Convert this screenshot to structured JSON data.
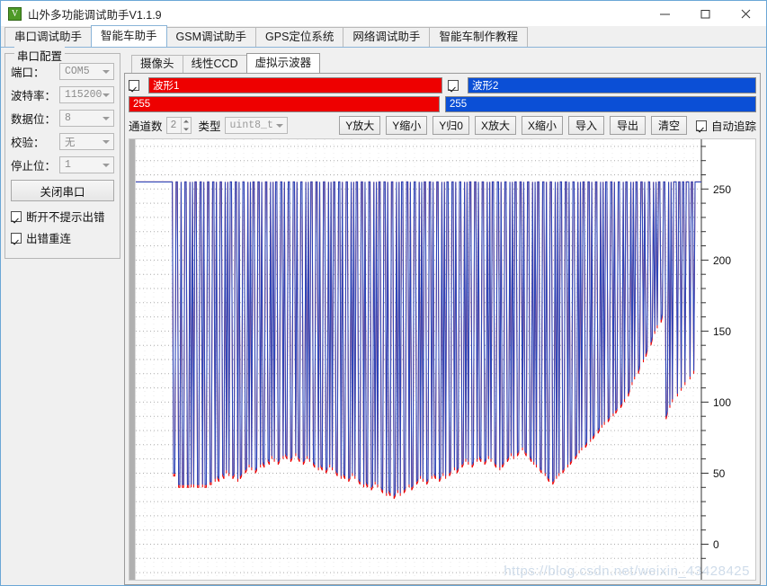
{
  "window": {
    "title": "山外多功能调试助手V1.1.9",
    "icon": "app-logo-icon",
    "minimize_label": "—",
    "maximize_label": "□",
    "close_label": "✕",
    "frame_color": "#6ba7d6"
  },
  "tabs": [
    {
      "label": "串口调试助手",
      "active": false
    },
    {
      "label": "智能车助手",
      "active": true
    },
    {
      "label": "GSM调试助手",
      "active": false
    },
    {
      "label": "GPS定位系统",
      "active": false
    },
    {
      "label": "网络调试助手",
      "active": false
    },
    {
      "label": "智能车制作教程",
      "active": false
    }
  ],
  "sidebar": {
    "group_title": "串口配置",
    "fields": [
      {
        "label": "端口：",
        "value": "COM5"
      },
      {
        "label": "波特率：",
        "value": "115200"
      },
      {
        "label": "数据位：",
        "value": "8"
      },
      {
        "label": "校验：",
        "value": "无"
      },
      {
        "label": "停止位：",
        "value": "1"
      }
    ],
    "action_button": "关闭串口",
    "checkboxes": [
      {
        "label": "断开不提示出错",
        "checked": true
      },
      {
        "label": "出错重连",
        "checked": true
      }
    ]
  },
  "inner_tabs": [
    {
      "label": "摄像头",
      "active": false
    },
    {
      "label": "线性CCD",
      "active": false
    },
    {
      "label": "虚拟示波器",
      "active": true
    }
  ],
  "scope": {
    "waves": [
      {
        "name": "波形1",
        "value": "255",
        "color": "#ee0000",
        "enabled": true
      },
      {
        "name": "波形2",
        "value": "255",
        "color": "#0b4fd6",
        "enabled": true
      }
    ],
    "channel_label": "通道数",
    "channel_count": "2",
    "type_label": "类型",
    "type_value": "uint8_t",
    "buttons": [
      "Y放大",
      "Y缩小",
      "Y归0",
      "X放大",
      "X缩小",
      "导入",
      "导出",
      "清空"
    ],
    "autotrack": {
      "label": "自动追踪",
      "checked": true
    },
    "watermark": "https://blog.csdn.net/weixin_43428425"
  },
  "chart_data": {
    "type": "line",
    "title": "",
    "xlabel": "",
    "ylabel": "",
    "grid": true,
    "legend": [
      "波形1",
      "波形2"
    ],
    "ylim": [
      -25,
      285
    ],
    "yticks": [
      0,
      50,
      100,
      150,
      200,
      250
    ],
    "yticks_minor_step": 10,
    "xlim": [
      0,
      470
    ],
    "series": [
      {
        "name": "波形1",
        "color": "#ee0000",
        "values": [
          255,
          255,
          255,
          255,
          255,
          255,
          255,
          255,
          255,
          255,
          255,
          255,
          255,
          255,
          255,
          255,
          255,
          255,
          255,
          255,
          255,
          255,
          255,
          255,
          255,
          255,
          255,
          255,
          255,
          255,
          48,
          48,
          255,
          255,
          40,
          40,
          255,
          40,
          40,
          255,
          255,
          40,
          40,
          255,
          40,
          255,
          40,
          255,
          255,
          40,
          40,
          255,
          255,
          40,
          255,
          40,
          40,
          255,
          255,
          42,
          42,
          255,
          255,
          44,
          255,
          46,
          44,
          255,
          255,
          48,
          46,
          255,
          50,
          255,
          48,
          255,
          255,
          46,
          48,
          255,
          255,
          44,
          255,
          46,
          48,
          255,
          255,
          50,
          52,
          255,
          54,
          255,
          52,
          255,
          255,
          50,
          52,
          255,
          255,
          54,
          255,
          56,
          54,
          255,
          255,
          58,
          56,
          255,
          60,
          255,
          58,
          255,
          255,
          56,
          58,
          255,
          255,
          60,
          255,
          62,
          60,
          255,
          255,
          58,
          60,
          255,
          255,
          62,
          255,
          60,
          58,
          255,
          255,
          56,
          58,
          255,
          60,
          255,
          58,
          255,
          255,
          56,
          54,
          255,
          255,
          52,
          255,
          54,
          52,
          255,
          255,
          50,
          52,
          255,
          54,
          255,
          52,
          255,
          255,
          50,
          48,
          255,
          255,
          46,
          255,
          48,
          46,
          255,
          255,
          44,
          46,
          255,
          48,
          255,
          46,
          255,
          255,
          44,
          42,
          255,
          255,
          40,
          255,
          42,
          40,
          255,
          255,
          38,
          40,
          255,
          42,
          255,
          40,
          255,
          255,
          38,
          36,
          255,
          255,
          34,
          255,
          36,
          34,
          255,
          255,
          32,
          34,
          255,
          36,
          255,
          34,
          255,
          255,
          36,
          38,
          255,
          255,
          40,
          255,
          38,
          40,
          255,
          255,
          42,
          44,
          255,
          46,
          255,
          44,
          255,
          255,
          42,
          44,
          255,
          255,
          46,
          255,
          48,
          46,
          255,
          255,
          44,
          46,
          255,
          48,
          255,
          46,
          255,
          255,
          48,
          50,
          255,
          255,
          52,
          255,
          50,
          52,
          255,
          255,
          54,
          56,
          255,
          58,
          255,
          56,
          255,
          255,
          54,
          56,
          255,
          255,
          58,
          255,
          60,
          58,
          255,
          255,
          56,
          58,
          255,
          60,
          255,
          58,
          255,
          255,
          56,
          54,
          255,
          255,
          52,
          255,
          54,
          56,
          255,
          255,
          58,
          60,
          255,
          62,
          255,
          60,
          255,
          255,
          62,
          64,
          255,
          255,
          66,
          255,
          64,
          62,
          255,
          255,
          60,
          58,
          255,
          56,
          255,
          54,
          255,
          255,
          52,
          50,
          255,
          255,
          48,
          255,
          46,
          44,
          255,
          255,
          42,
          44,
          255,
          46,
          255,
          48,
          255,
          255,
          50,
          52,
          255,
          255,
          54,
          255,
          56,
          58,
          255,
          255,
          60,
          62,
          255,
          64,
          255,
          66,
          255,
          255,
          68,
          70,
          255,
          255,
          72,
          255,
          74,
          76,
          255,
          255,
          78,
          80,
          255,
          82,
          255,
          84,
          255,
          255,
          86,
          88,
          255,
          255,
          90,
          255,
          92,
          94,
          255,
          255,
          96,
          98,
          255,
          100,
          255,
          255,
          104,
          108,
          255,
          112,
          255,
          116,
          255,
          255,
          120,
          124,
          255,
          255,
          128,
          255,
          132,
          136,
          255,
          255,
          140,
          144,
          255,
          148,
          255,
          152,
          255,
          255,
          156,
          160,
          255,
          255,
          88,
          92,
          255,
          96,
          255,
          100,
          255,
          255,
          255,
          104,
          255,
          255,
          108,
          255,
          255,
          112,
          255,
          255,
          255,
          116,
          255,
          255,
          120,
          255,
          255,
          255,
          255,
          255,
          255
        ]
      },
      {
        "name": "波形2",
        "color": "#0b4fd6",
        "values": [
          255,
          255,
          255,
          255,
          255,
          255,
          255,
          255,
          255,
          255,
          255,
          255,
          255,
          255,
          255,
          255,
          255,
          255,
          255,
          255,
          255,
          255,
          255,
          255,
          255,
          255,
          255,
          255,
          255,
          255,
          50,
          50,
          255,
          255,
          42,
          42,
          255,
          42,
          42,
          255,
          255,
          42,
          42,
          255,
          42,
          255,
          42,
          255,
          255,
          42,
          42,
          255,
          255,
          42,
          255,
          42,
          42,
          255,
          255,
          44,
          44,
          255,
          255,
          46,
          255,
          48,
          46,
          255,
          255,
          50,
          48,
          255,
          52,
          255,
          50,
          255,
          255,
          48,
          50,
          255,
          255,
          46,
          255,
          48,
          50,
          255,
          255,
          52,
          54,
          255,
          56,
          255,
          54,
          255,
          255,
          52,
          54,
          255,
          255,
          56,
          255,
          58,
          56,
          255,
          255,
          60,
          58,
          255,
          62,
          255,
          60,
          255,
          255,
          58,
          60,
          255,
          255,
          62,
          255,
          64,
          62,
          255,
          255,
          60,
          62,
          255,
          255,
          64,
          255,
          62,
          60,
          255,
          255,
          58,
          60,
          255,
          62,
          255,
          60,
          255,
          255,
          58,
          56,
          255,
          255,
          54,
          255,
          56,
          54,
          255,
          255,
          52,
          54,
          255,
          56,
          255,
          54,
          255,
          255,
          52,
          50,
          255,
          255,
          48,
          255,
          50,
          48,
          255,
          255,
          46,
          48,
          255,
          50,
          255,
          48,
          255,
          255,
          46,
          44,
          255,
          255,
          42,
          255,
          44,
          42,
          255,
          255,
          40,
          42,
          255,
          44,
          255,
          42,
          255,
          255,
          40,
          38,
          255,
          255,
          36,
          255,
          38,
          36,
          255,
          255,
          34,
          36,
          255,
          38,
          255,
          36,
          255,
          255,
          38,
          40,
          255,
          255,
          42,
          255,
          40,
          42,
          255,
          255,
          44,
          46,
          255,
          48,
          255,
          46,
          255,
          255,
          44,
          46,
          255,
          255,
          48,
          255,
          50,
          48,
          255,
          255,
          46,
          48,
          255,
          50,
          255,
          48,
          255,
          255,
          50,
          52,
          255,
          255,
          54,
          255,
          52,
          54,
          255,
          255,
          56,
          58,
          255,
          60,
          255,
          58,
          255,
          255,
          56,
          58,
          255,
          255,
          60,
          255,
          62,
          60,
          255,
          255,
          58,
          60,
          255,
          62,
          255,
          60,
          255,
          255,
          58,
          56,
          255,
          255,
          54,
          255,
          56,
          58,
          255,
          255,
          60,
          62,
          255,
          64,
          255,
          62,
          255,
          255,
          64,
          66,
          255,
          255,
          68,
          255,
          66,
          64,
          255,
          255,
          62,
          60,
          255,
          58,
          255,
          56,
          255,
          255,
          54,
          52,
          255,
          255,
          50,
          255,
          48,
          46,
          255,
          255,
          44,
          46,
          255,
          48,
          255,
          50,
          255,
          255,
          52,
          54,
          255,
          255,
          56,
          255,
          58,
          60,
          255,
          255,
          62,
          64,
          255,
          66,
          255,
          68,
          255,
          255,
          70,
          72,
          255,
          255,
          74,
          255,
          76,
          78,
          255,
          255,
          80,
          82,
          255,
          84,
          255,
          86,
          255,
          255,
          88,
          90,
          255,
          255,
          92,
          255,
          94,
          96,
          255,
          255,
          98,
          100,
          255,
          102,
          255,
          255,
          106,
          110,
          255,
          114,
          255,
          118,
          255,
          255,
          122,
          126,
          255,
          255,
          130,
          255,
          134,
          138,
          255,
          255,
          142,
          146,
          255,
          150,
          255,
          154,
          255,
          255,
          158,
          162,
          255,
          255,
          90,
          94,
          255,
          98,
          255,
          102,
          255,
          255,
          255,
          106,
          255,
          255,
          110,
          255,
          255,
          114,
          255,
          255,
          255,
          118,
          255,
          255,
          122,
          255,
          255,
          255,
          255,
          255,
          255
        ]
      }
    ]
  }
}
